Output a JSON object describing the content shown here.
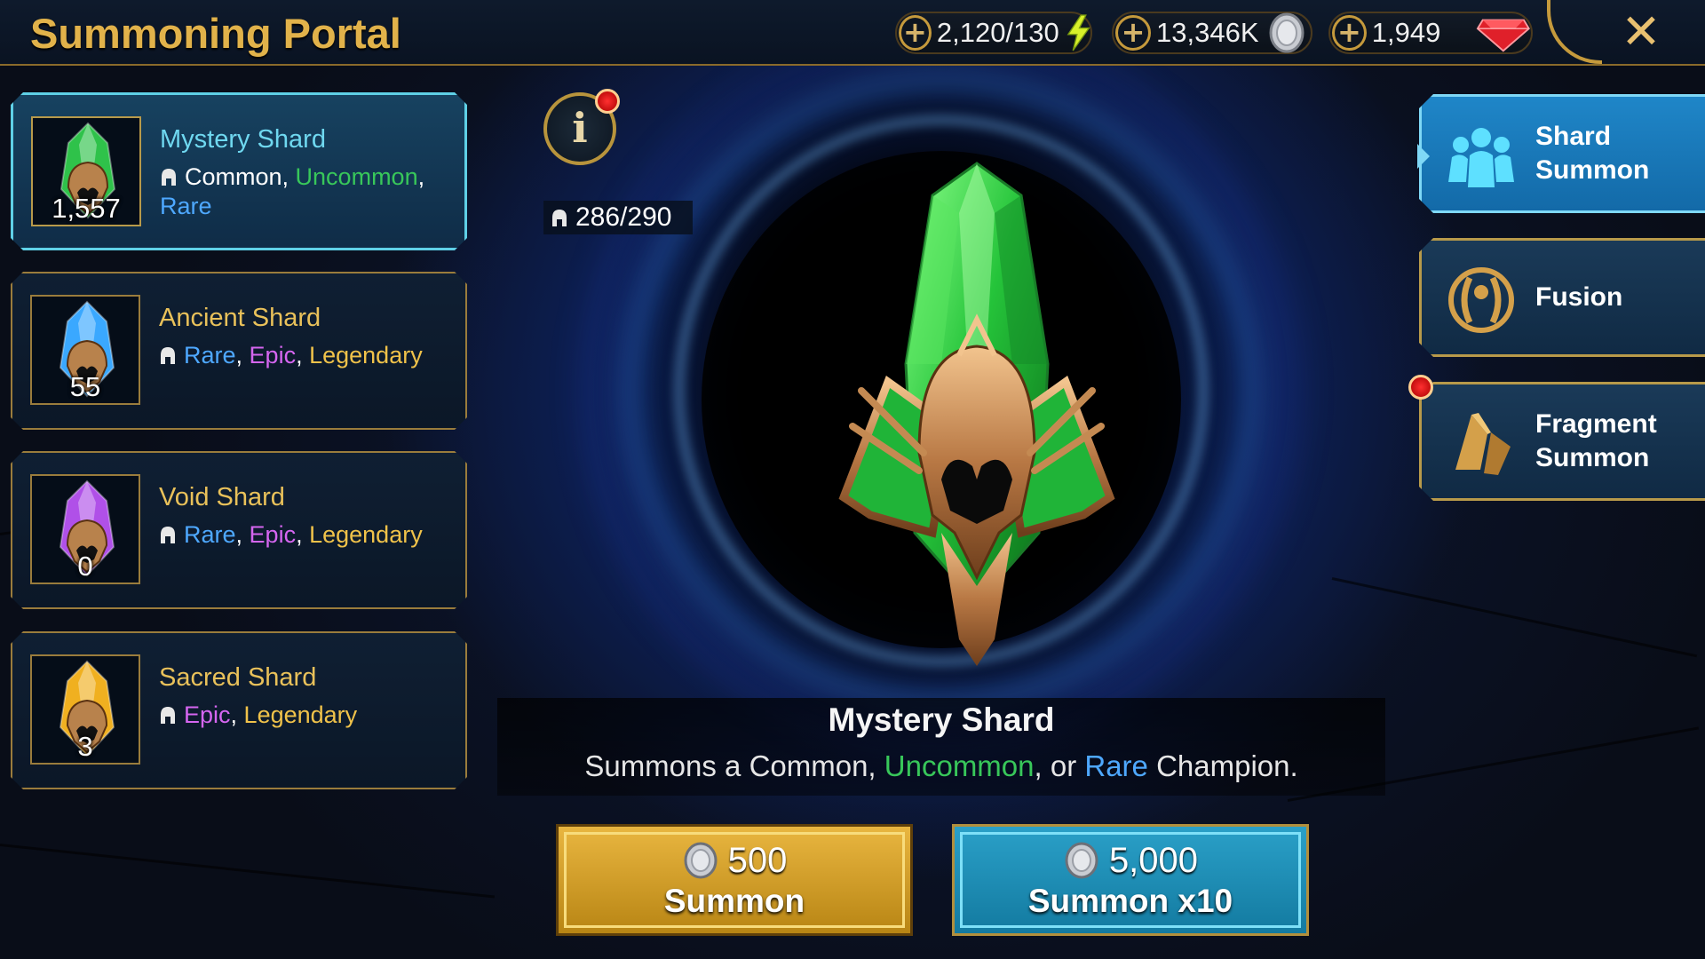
{
  "header": {
    "title": "Summoning Portal",
    "resources": [
      {
        "icon": "energy-bolt-icon",
        "value": "2,120/130"
      },
      {
        "icon": "silver-coin-icon",
        "value": "13,346K"
      },
      {
        "icon": "ruby-gem-icon",
        "value": "1,949"
      }
    ],
    "close_label": "✕"
  },
  "shards": [
    {
      "name": "Mystery Shard",
      "count": "1,557",
      "color": "#2fc24a",
      "active": true,
      "rarities": [
        {
          "label": "Common",
          "class": "common"
        },
        {
          "label": "Uncommon",
          "class": "uncommon"
        },
        {
          "label": "Rare",
          "class": "rare"
        }
      ]
    },
    {
      "name": "Ancient Shard",
      "count": "55",
      "color": "#3aa8ff",
      "active": false,
      "rarities": [
        {
          "label": "Rare",
          "class": "rare"
        },
        {
          "label": "Epic",
          "class": "epic"
        },
        {
          "label": "Legendary",
          "class": "legendary"
        }
      ]
    },
    {
      "name": "Void Shard",
      "count": "0",
      "color": "#b050e8",
      "active": false,
      "rarities": [
        {
          "label": "Rare",
          "class": "rare"
        },
        {
          "label": "Epic",
          "class": "epic"
        },
        {
          "label": "Legendary",
          "class": "legendary"
        }
      ]
    },
    {
      "name": "Sacred Shard",
      "count": "3",
      "color": "#f0b020",
      "active": false,
      "rarities": [
        {
          "label": "Epic",
          "class": "epic"
        },
        {
          "label": "Legendary",
          "class": "legendary"
        }
      ]
    }
  ],
  "portal": {
    "info_label": "i",
    "champion_capacity": "286/290",
    "selected_name": "Mystery Shard",
    "description_parts": [
      {
        "text": "Summons a Common, ",
        "class": "common"
      },
      {
        "text": "Uncommon",
        "class": "uncommon"
      },
      {
        "text": ", or ",
        "class": "common"
      },
      {
        "text": "Rare",
        "class": "rare"
      },
      {
        "text": " Champion.",
        "class": "common"
      }
    ]
  },
  "summon_buttons": {
    "single": {
      "cost": "500",
      "label": "Summon"
    },
    "multi": {
      "cost": "5,000",
      "label": "Summon x10"
    }
  },
  "right_menu": [
    {
      "line1": "Shard",
      "line2": "Summon",
      "icon": "shard-summon-icon",
      "active": true
    },
    {
      "line1": "Fusion",
      "line2": "",
      "icon": "fusion-icon",
      "active": false
    },
    {
      "line1": "Fragment",
      "line2": "Summon",
      "icon": "fragment-summon-icon",
      "active": false
    }
  ],
  "colors": {
    "title_gold": "#e1b24a",
    "uncommon": "#38c75a",
    "rare": "#4ea8ff",
    "epic": "#d566f0",
    "legendary": "#f0c24a",
    "active_cyan": "#6fd8f0"
  }
}
